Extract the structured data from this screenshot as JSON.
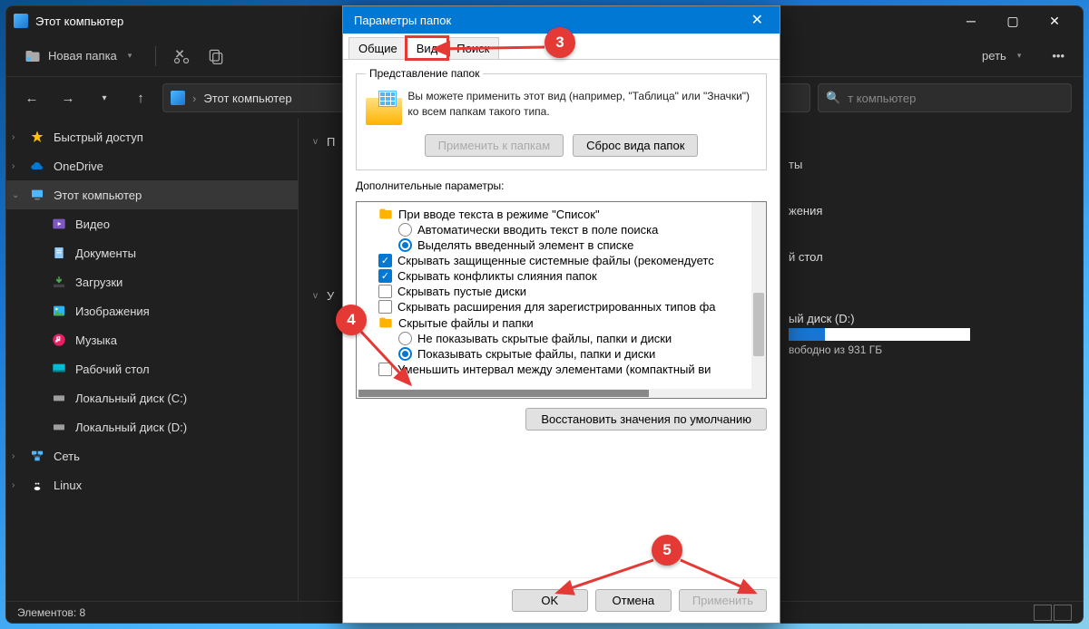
{
  "explorer": {
    "title": "Этот компьютер",
    "new_folder": "Новая папка",
    "view_btn": "реть",
    "breadcrumb": "Этот компьютер",
    "search_placeholder": "т компьютер",
    "status": "Элементов: 8",
    "sidebar": [
      {
        "label": "Быстрый доступ",
        "icon": "star",
        "expand": ">"
      },
      {
        "label": "OneDrive",
        "icon": "cloud",
        "expand": ">"
      },
      {
        "label": "Этот компьютер",
        "icon": "pc",
        "expand": "v",
        "sel": true
      },
      {
        "label": "Видео",
        "icon": "video",
        "sub": true
      },
      {
        "label": "Документы",
        "icon": "doc",
        "sub": true
      },
      {
        "label": "Загрузки",
        "icon": "down",
        "sub": true
      },
      {
        "label": "Изображения",
        "icon": "img",
        "sub": true
      },
      {
        "label": "Музыка",
        "icon": "music",
        "sub": true
      },
      {
        "label": "Рабочий стол",
        "icon": "desk",
        "sub": true
      },
      {
        "label": "Локальный диск (C:)",
        "icon": "disk",
        "sub": true
      },
      {
        "label": "Локальный диск (D:)",
        "icon": "disk",
        "sub": true
      },
      {
        "label": "Сеть",
        "icon": "net",
        "expand": ">"
      },
      {
        "label": "Linux",
        "icon": "linux",
        "expand": ">"
      }
    ],
    "main": {
      "group1": {
        "head": "П",
        "expand": "v"
      },
      "group2": {
        "head": "У",
        "expand": "v"
      },
      "right_items": [
        "ты",
        "жения",
        "й стол"
      ],
      "disk": {
        "name": "ый диск (D:)",
        "sub": "вободно из 931 ГБ",
        "fill": 20
      }
    }
  },
  "dialog": {
    "title": "Параметры папок",
    "tabs": [
      "Общие",
      "Вид",
      "Поиск"
    ],
    "folderview": {
      "legend": "Представление папок",
      "desc": "Вы можете применить этот вид (например, \"Таблица\" или \"Значки\") ко всем папкам такого типа.",
      "apply": "Применить к папкам",
      "reset": "Сброс вида папок"
    },
    "adv_label": "Дополнительные параметры:",
    "tree": [
      {
        "type": "folder",
        "label": "При вводе текста в режиме \"Список\""
      },
      {
        "type": "radio",
        "label": "Автоматически вводить текст в поле поиска",
        "sel": false,
        "lvl": 2
      },
      {
        "type": "radio",
        "label": "Выделять введенный элемент в списке",
        "sel": true,
        "lvl": 2
      },
      {
        "type": "check",
        "label": "Скрывать защищенные системные файлы (рекомендуетс",
        "checked": true
      },
      {
        "type": "check",
        "label": "Скрывать конфликты слияния папок",
        "checked": true
      },
      {
        "type": "check",
        "label": "Скрывать пустые диски",
        "checked": false
      },
      {
        "type": "check",
        "label": "Скрывать расширения для зарегистрированных типов фа",
        "checked": false
      },
      {
        "type": "folder",
        "label": "Скрытые файлы и папки"
      },
      {
        "type": "radio",
        "label": "Не показывать скрытые файлы, папки и диски",
        "sel": false,
        "lvl": 2
      },
      {
        "type": "radio",
        "label": "Показывать скрытые файлы, папки и диски",
        "sel": true,
        "lvl": 2
      },
      {
        "type": "check",
        "label": "Уменьшить интервал между элементами (компактный ви",
        "checked": false
      }
    ],
    "restore": "Восстановить значения по умолчанию",
    "ok": "OK",
    "cancel": "Отмена",
    "apply": "Применить"
  },
  "callouts": {
    "c3": "3",
    "c4": "4",
    "c5": "5"
  }
}
